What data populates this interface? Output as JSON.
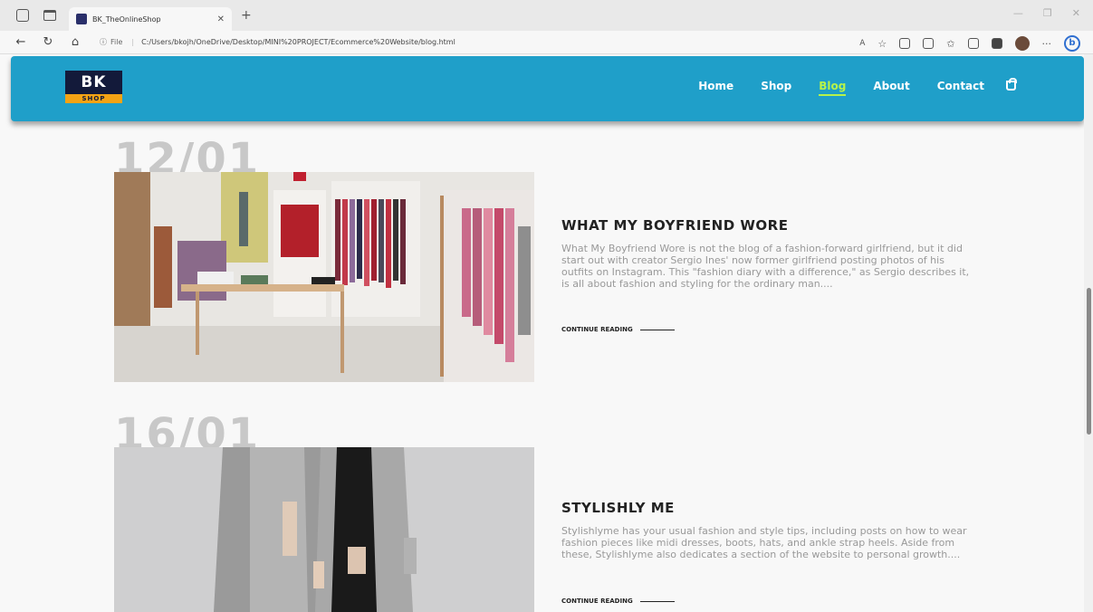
{
  "browser": {
    "tab_title": "BK_TheOnlineShop",
    "url_prefix": "File",
    "url": "C:/Users/bkojh/OneDrive/Desktop/MINI%20PROJECT/Ecommerce%20Website/blog.html"
  },
  "site": {
    "logo_top": "BK",
    "logo_bottom": "SHOP",
    "accent_color": "#1f9fc9",
    "active_color": "#b7f34a",
    "nav": [
      {
        "label": "Home"
      },
      {
        "label": "Shop"
      },
      {
        "label": "Blog"
      },
      {
        "label": "About"
      },
      {
        "label": "Contact"
      }
    ]
  },
  "posts": [
    {
      "date": "12/01",
      "title": "WHAT MY BOYFRIEND WORE",
      "text": "What My Boyfriend Wore is not the blog of a fashion-forward girlfriend, but it did start out with creator Sergio Ines' now former girlfriend posting photos of his outfits on Instagram. This \"fashion diary with a difference,\" as Sergio describes it, is all about fashion and styling for the ordinary man....",
      "cta": "CONTINUE READING"
    },
    {
      "date": "16/01",
      "title": "STYLISHLY ME",
      "text": "Stylishlyme has your usual fashion and style tips, including posts on how to wear fashion pieces like midi dresses, boots, hats, and ankle strap heels. Aside from these, Stylishlyme also dedicates a section of the website to personal growth....",
      "cta": "CONTINUE READING"
    }
  ]
}
